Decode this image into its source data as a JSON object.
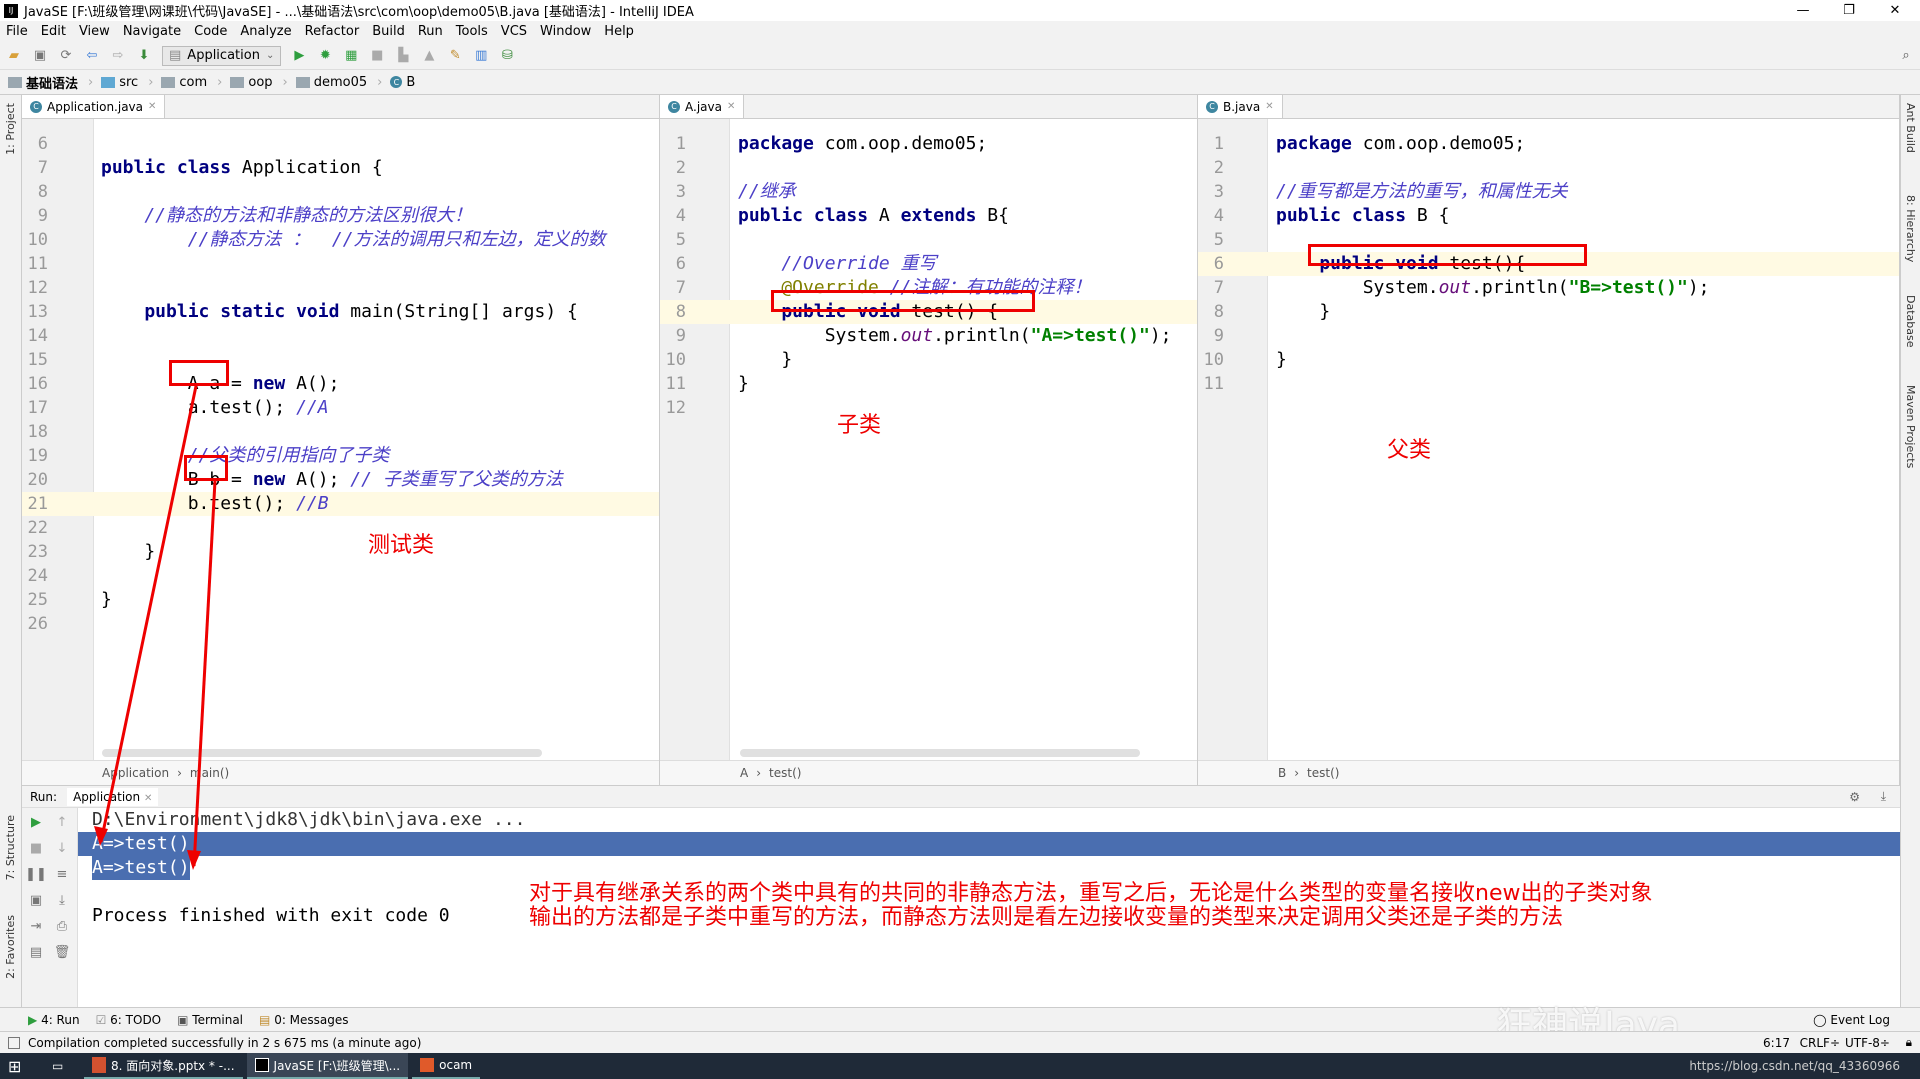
{
  "window": {
    "title": "JavaSE [F:\\班级管理\\网课班\\代码\\JavaSE] - ...\\基础语法\\src\\com\\oop\\demo05\\B.java [基础语法] - IntelliJ IDEA",
    "logo": "IJ",
    "minimize": "—",
    "restore": "❐",
    "close": "✕"
  },
  "menu": [
    "File",
    "Edit",
    "View",
    "Navigate",
    "Code",
    "Analyze",
    "Refactor",
    "Build",
    "Run",
    "Tools",
    "VCS",
    "Window",
    "Help"
  ],
  "toolbar": {
    "run_config": "Application",
    "icons": [
      "open-folder-icon",
      "save-icon",
      "sync-icon",
      "back-icon",
      "forward-icon",
      "build-icon",
      "run-icon",
      "debug-icon",
      "coverage-icon",
      "stop-icon",
      "attach-icon",
      "clean-icon",
      "project-structure-icon",
      "sdk-icon",
      "vcs-icon"
    ],
    "search_icon": "search-icon"
  },
  "navbar": [
    "基础语法",
    "src",
    "com",
    "oop",
    "demo05",
    "B"
  ],
  "left_strip": [
    "1: Project",
    "7: Structure",
    "2: Favorites"
  ],
  "right_strip": [
    "Ant Build",
    "8: Hierarchy",
    "Database",
    "Maven Projects"
  ],
  "editors": [
    {
      "tab": "Application.java",
      "crumbs": [
        "Application",
        "main()"
      ],
      "start": 6,
      "current": 21,
      "lines": [
        [],
        [
          [
            "public class ",
            "kw"
          ],
          [
            "Application {",
            ""
          ]
        ],
        [],
        [
          [
            "    //静态的方法和非静态的方法区别很大！",
            "cm"
          ]
        ],
        [
          [
            "        //静态方法 ：  //方法的调用只和左边，定义的数",
            "cm"
          ]
        ],
        [],
        [],
        [
          [
            "    public static void ",
            "kw"
          ],
          [
            "main(String[] args) {",
            ""
          ]
        ],
        [],
        [],
        [
          [
            "        A a = ",
            ""
          ],
          [
            "new ",
            "kw"
          ],
          [
            "A();",
            ""
          ]
        ],
        [
          [
            "        a.test(); ",
            ""
          ],
          [
            "//A",
            "cm"
          ]
        ],
        [],
        [
          [
            "        //父类的引用指向了子类",
            "cm"
          ]
        ],
        [
          [
            "        B b = ",
            ""
          ],
          [
            "new ",
            "kw"
          ],
          [
            "A(); ",
            ""
          ],
          [
            "// 子类重写了父类的方法",
            "cm"
          ]
        ],
        [
          [
            "        b.test(); ",
            ""
          ],
          [
            "//B",
            "cm"
          ]
        ],
        [],
        [
          [
            "    }",
            ""
          ]
        ],
        [],
        [
          [
            "}",
            ""
          ]
        ],
        []
      ]
    },
    {
      "tab": "A.java",
      "crumbs": [
        "A",
        "test()"
      ],
      "start": 1,
      "current": 8,
      "lines": [
        [
          [
            "package ",
            "kw"
          ],
          [
            "com.oop.demo05;",
            ""
          ]
        ],
        [],
        [
          [
            "//继承",
            "cm"
          ]
        ],
        [
          [
            "public class ",
            "kw"
          ],
          [
            "A ",
            ""
          ],
          [
            "extends ",
            "kw"
          ],
          [
            "B{",
            ""
          ]
        ],
        [],
        [
          [
            "    //Override 重写",
            "cm"
          ]
        ],
        [
          [
            "    @Override ",
            "ann"
          ],
          [
            "//注解：有功能的注释！",
            "cm"
          ]
        ],
        [
          [
            "    public void ",
            "kw"
          ],
          [
            "test() {",
            ""
          ]
        ],
        [
          [
            "        System.",
            ""
          ],
          [
            "out",
            "fld"
          ],
          [
            ".println(",
            ""
          ],
          [
            "\"A=>test()\"",
            "str"
          ],
          [
            ");",
            ""
          ]
        ],
        [
          [
            "    }",
            ""
          ]
        ],
        [
          [
            "}",
            ""
          ]
        ],
        []
      ]
    },
    {
      "tab": "B.java",
      "crumbs": [
        "B",
        "test()"
      ],
      "start": 1,
      "current": 6,
      "lines": [
        [
          [
            "package ",
            "kw"
          ],
          [
            "com.oop.demo05;",
            ""
          ]
        ],
        [],
        [
          [
            "//重写都是方法的重写，和属性无关",
            "cm"
          ]
        ],
        [
          [
            "public class ",
            "kw"
          ],
          [
            "B {",
            ""
          ]
        ],
        [],
        [
          [
            "    public void ",
            "kw"
          ],
          [
            "test(){",
            ""
          ]
        ],
        [
          [
            "        System.",
            ""
          ],
          [
            "out",
            "fld"
          ],
          [
            ".println(",
            ""
          ],
          [
            "\"B=>test()\"",
            "str"
          ],
          [
            ");",
            ""
          ]
        ],
        [
          [
            "    }",
            ""
          ]
        ],
        [],
        [
          [
            "}",
            ""
          ]
        ],
        []
      ]
    }
  ],
  "annotations": {
    "test_class": "测试类",
    "subclass": "子类",
    "superclass": "父类",
    "note_line1": "对于具有继承关系的两个类中具有的共同的非静态方法，重写之后，无论是什么类型的变量名接收new出的子类对象",
    "note_line2": "输出的方法都是子类中重写的方法，而静态方法则是看左边接收变量的类型来决定调用父类还是子类的方法",
    "color": "#ee0000"
  },
  "run": {
    "label": "Run:",
    "tab": "Application",
    "console": [
      "D:\\Environment\\jdk8\\jdk\\bin\\java.exe ...",
      "A=>test()",
      "A=>test()",
      "",
      "Process finished with exit code 0"
    ],
    "selection_color": "#4a6eb0"
  },
  "bottom_tabs": [
    "4: Run",
    "6: TODO",
    "Terminal",
    "0: Messages"
  ],
  "event_log": "Event Log",
  "status": {
    "message": "Compilation completed successfully in 2 s 675 ms (a minute ago)",
    "position": "6:17",
    "line_sep": "CRLF÷",
    "encoding": "UTF-8÷"
  },
  "taskbar": {
    "items": [
      "8. 面向对象.pptx * -...",
      "JavaSE [F:\\班级管理\\...",
      "ocam"
    ],
    "watermark": "狂神说Java",
    "url": "https://blog.csdn.net/qq_43360966"
  }
}
